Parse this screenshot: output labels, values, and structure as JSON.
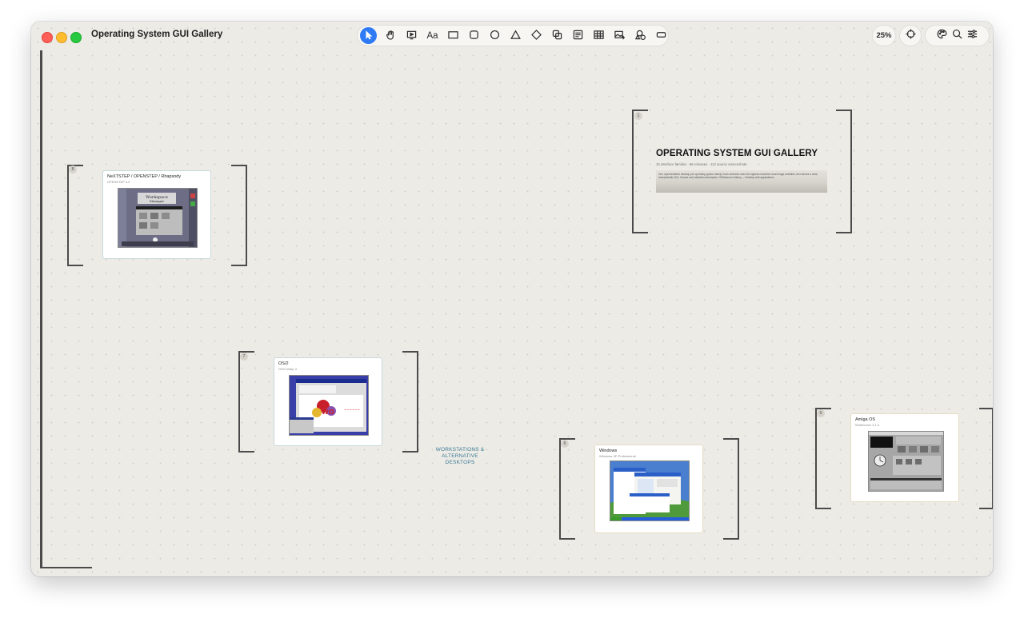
{
  "window": {
    "title": "Operating System GUI Gallery"
  },
  "toolbar": {
    "tools": [
      {
        "name": "select-tool",
        "icon": "cursor-arrow-icon",
        "active": true
      },
      {
        "name": "hand-tool",
        "icon": "hand-icon"
      },
      {
        "name": "present-tool",
        "icon": "presentation-icon"
      },
      {
        "name": "text-tool",
        "label": "Aa"
      },
      {
        "name": "rectangle-tool",
        "icon": "rectangle-icon"
      },
      {
        "name": "rounded-rectangle-tool",
        "icon": "rounded-rectangle-icon"
      },
      {
        "name": "circle-tool",
        "icon": "circle-icon"
      },
      {
        "name": "triangle-tool",
        "icon": "triangle-icon"
      },
      {
        "name": "diamond-tool",
        "icon": "diamond-icon"
      },
      {
        "name": "shapes-tool",
        "icon": "overlapping-squares-icon"
      },
      {
        "name": "note-tool",
        "icon": "note-icon"
      },
      {
        "name": "table-tool",
        "icon": "table-icon"
      },
      {
        "name": "image-tool",
        "icon": "image-add-icon"
      },
      {
        "name": "stickers-tool",
        "icon": "shapes-add-icon"
      },
      {
        "name": "frame-tool",
        "icon": "frame-icon"
      }
    ],
    "zoom": "25%",
    "accent_color": "#2f7bf6"
  },
  "right_tools": [
    "crosshair-icon",
    "palette-icon",
    "search-icon",
    "sliders-icon"
  ],
  "hero": {
    "number": "1",
    "title": "OPERATING SYSTEM GUI GALLERY",
    "subtitle": "15 interface families · 66 releases · 112 source screenshots",
    "description": "One representative desktop per operating system family. Each selection uses the highest-resolution local image available, then favors a clear, characteristic GUI. Source and collection description: OSMuseum Gallery — Desktop with applications."
  },
  "cards": [
    {
      "number": "8",
      "title": "NeXTSTEP / OPENSTEP / Rhapsody",
      "subtitle": "OPENSTEP 4.2"
    },
    {
      "number": "7",
      "title": "OS/2",
      "subtitle": "OS/2 Warp 4"
    },
    {
      "number": "6",
      "title": "Windows",
      "subtitle": "Windows XP Professional"
    },
    {
      "number": "5",
      "title": "Amiga OS",
      "subtitle": "Workbench 3.1.4"
    }
  ],
  "section_label": "WORKSTATIONS & ALTERNATIVE DESKTOPS",
  "colors": {
    "canvas": "#edebe6",
    "bracket": "#4b4b4b",
    "section_label": "#3a7c96"
  }
}
